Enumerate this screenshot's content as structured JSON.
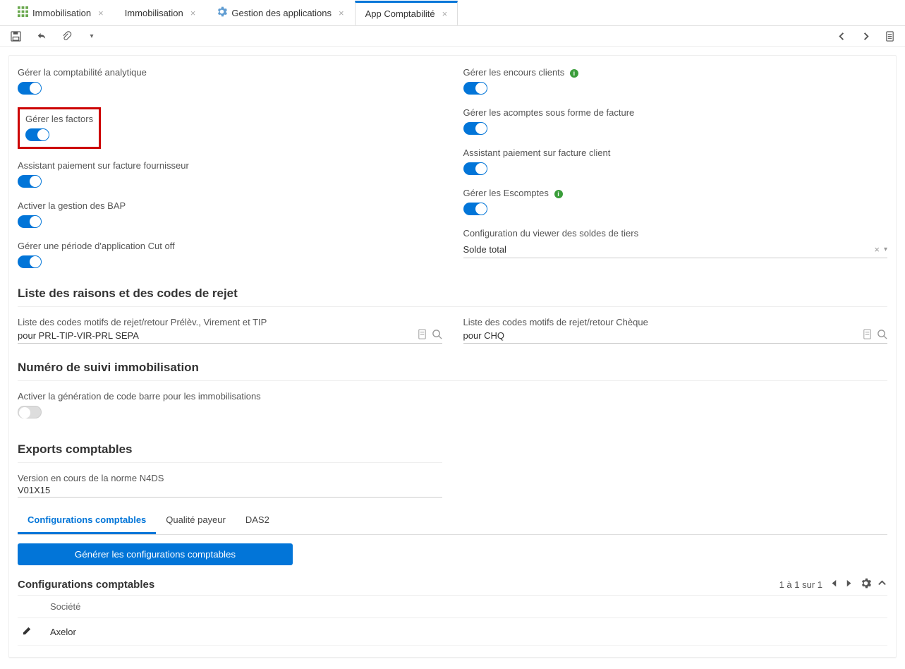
{
  "tabs": [
    {
      "label": "Immobilisation",
      "icon": "grid"
    },
    {
      "label": "Immobilisation"
    },
    {
      "label": "Gestion des applications",
      "icon": "gear"
    },
    {
      "label": "App Comptabilité",
      "active": true
    }
  ],
  "settings": {
    "left": [
      {
        "label": "Gérer la comptabilité analytique",
        "on": true
      },
      {
        "label": "Gérer les factors",
        "on": true,
        "highlight": true
      },
      {
        "label": "Assistant paiement sur facture fournisseur",
        "on": true
      },
      {
        "label": "Activer la gestion des BAP",
        "on": true
      },
      {
        "label": "Gérer une période d'application Cut off",
        "on": true
      }
    ],
    "right": [
      {
        "label": "Gérer les encours clients",
        "on": true,
        "info": true
      },
      {
        "label": "Gérer les acomptes sous forme de facture",
        "on": true
      },
      {
        "label": "Assistant paiement sur facture client",
        "on": true
      },
      {
        "label": "Gérer les Escomptes",
        "on": true,
        "info": true
      }
    ],
    "viewerConfig": {
      "label": "Configuration du viewer des soldes de tiers",
      "value": "Solde total"
    }
  },
  "section_reject": {
    "title": "Liste des raisons et des codes de rejet",
    "left": {
      "label": "Liste des codes motifs de rejet/retour Prélèv., Virement et TIP",
      "value": "pour PRL-TIP-VIR-PRL SEPA"
    },
    "right": {
      "label": "Liste des codes motifs de rejet/retour Chèque",
      "value": "pour CHQ"
    }
  },
  "section_immo": {
    "title": "Numéro de suivi immobilisation",
    "toggle": {
      "label": "Activer la génération de code barre pour les immobilisations",
      "on": false
    }
  },
  "section_export": {
    "title": "Exports comptables",
    "field": {
      "label": "Version en cours de la norme N4DS",
      "value": "V01X15"
    }
  },
  "inner_tabs": [
    "Configurations comptables",
    "Qualité payeur",
    "DAS2"
  ],
  "button_generate": "Générer les configurations comptables",
  "config_table": {
    "title": "Configurations comptables",
    "paging": "1 à 1 sur 1",
    "column": "Société",
    "row": "Axelor"
  }
}
